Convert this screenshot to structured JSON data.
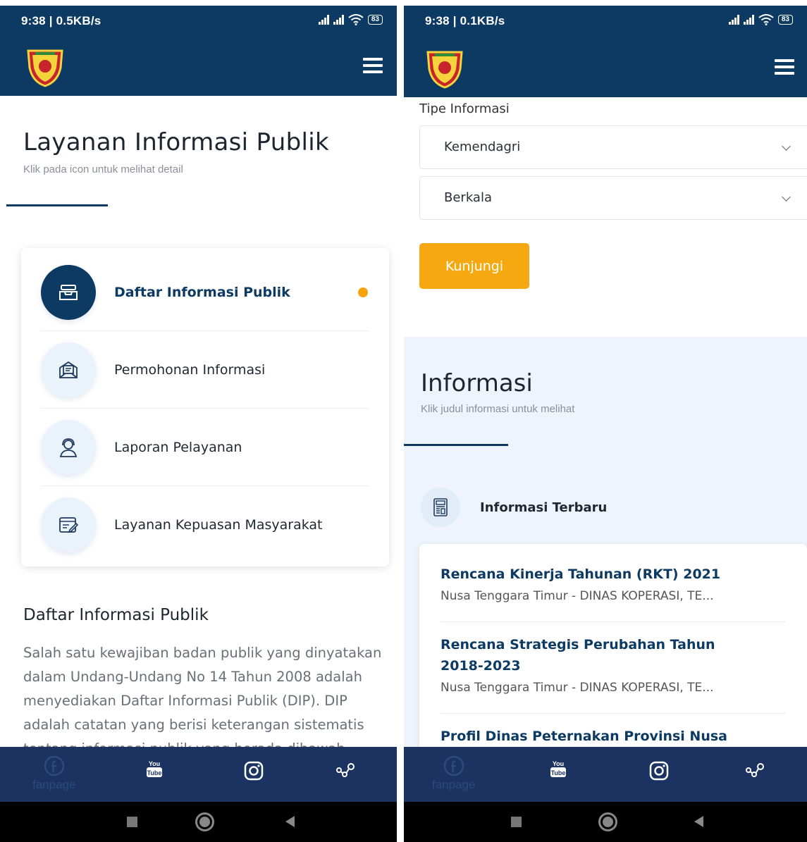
{
  "left_screen": {
    "status": {
      "time": "9:38 | 0.5KB/s",
      "battery": "83"
    },
    "title": "Layanan Informasi Publik",
    "subtitle": "Klik pada icon untuk melihat detail",
    "menu": [
      {
        "label": "Daftar Informasi Publik",
        "icon": "inbox-tray-icon",
        "active": true
      },
      {
        "label": "Permohonan Informasi",
        "icon": "envelope-letter-icon",
        "active": false
      },
      {
        "label": "Laporan Pelayanan",
        "icon": "customer-service-icon",
        "active": false
      },
      {
        "label": "Layanan Kepuasan Masyarakat",
        "icon": "survey-form-icon",
        "active": false
      }
    ],
    "section_title": "Daftar Informasi Publik",
    "paragraph": "Salah satu kewajiban badan publik yang dinyatakan dalam Undang-Undang No 14 Tahun 2008 adalah menyediakan Daftar Informasi Publik (DIP). DIP adalah catatan yang berisi keterangan sistematis tentang informasi publik yang berada dibawah"
  },
  "right_screen": {
    "status": {
      "time": "9:38 | 0.1KB/s",
      "battery": "83"
    },
    "filter_label": "Tipe Informasi",
    "select_1": "Kemendagri",
    "select_2": "Berkala",
    "button": "Kunjungi",
    "section_title": "Informasi",
    "section_subtitle": "Klik judul informasi untuk melihat",
    "latest_label": "Informasi Terbaru",
    "news": [
      {
        "title": "Rencana Kinerja Tahunan (RKT) 2021",
        "meta": "Nusa Tenggara Timur - DINAS KOPERASI, TE..."
      },
      {
        "title": "Rencana Strategis Perubahan Tahun 2018-2023",
        "meta": "Nusa Tenggara Timur - DINAS KOPERASI, TE..."
      },
      {
        "title": "Profil Dinas Peternakan Provinsi Nusa",
        "meta": ""
      }
    ]
  },
  "footer": {
    "fanpage_label": "fanpage",
    "youtube_top": "You",
    "youtube_bottom": "Tube"
  },
  "colors": {
    "navy": "#0d3a63",
    "footer": "#1c3260",
    "accent": "#f5a80f",
    "light_bg": "#eef4fb"
  }
}
